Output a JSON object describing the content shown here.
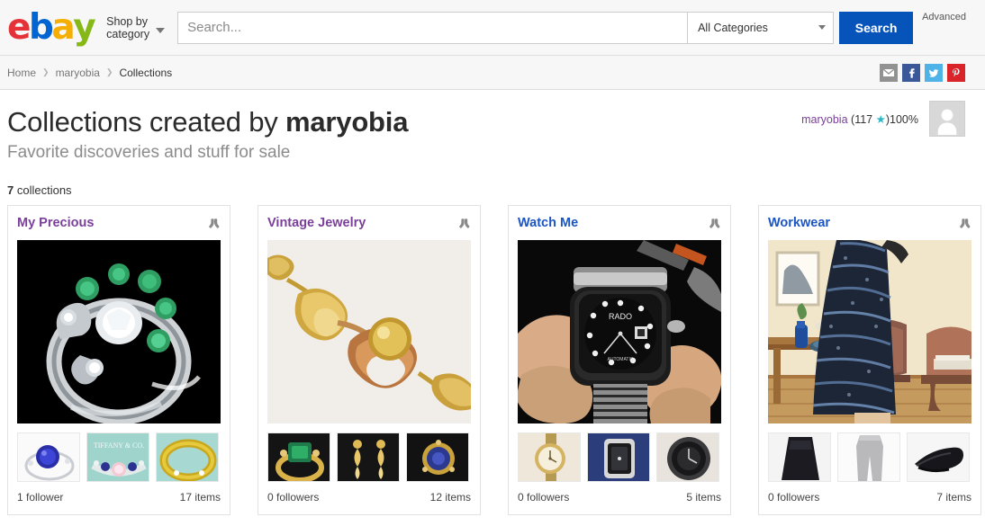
{
  "header": {
    "logo": {
      "letters": [
        "e",
        "b",
        "a",
        "y"
      ],
      "colors": [
        "#e53238",
        "#0064d2",
        "#f5af02",
        "#86b817"
      ]
    },
    "shop_by_category": "Shop by\ncategory",
    "shop_by_line1": "Shop by",
    "shop_by_line2": "category",
    "search_placeholder": "Search...",
    "search_value": "",
    "category_selected": "All Categories",
    "search_button": "Search",
    "advanced_link": "Advanced"
  },
  "breadcrumb": {
    "items": [
      {
        "label": "Home",
        "current": false
      },
      {
        "label": "maryobia",
        "current": false
      },
      {
        "label": "Collections",
        "current": true
      }
    ],
    "separator": "❯"
  },
  "social": [
    {
      "name": "email-share-icon",
      "label": "Email",
      "color": "#929292"
    },
    {
      "name": "facebook-share-icon",
      "label": "Facebook",
      "color": "#3b5998"
    },
    {
      "name": "twitter-share-icon",
      "label": "Twitter",
      "color": "#4fb3e8"
    },
    {
      "name": "pinterest-share-icon",
      "label": "Pinterest",
      "color": "#d9242a"
    }
  ],
  "page": {
    "title_prefix": "Collections created by ",
    "title_owner": "maryobia",
    "subtitle": "Favorite discoveries and stuff for sale",
    "user": {
      "name": "maryobia",
      "feedback_open": "(",
      "feedback_score": "117",
      "star": "★",
      "feedback_close": ")",
      "positive_percent": "100%"
    },
    "collections_count": "7",
    "collections_label": "collections"
  },
  "collections": [
    {
      "title": "My Precious",
      "visited": true,
      "followers": "1 follower",
      "items": "17 items",
      "hero_alt": "silver ring with diamonds and emeralds on black background",
      "thumbs": [
        "sapphire ring on white",
        "Tiffany & Co band on teal",
        "gold band on teal"
      ]
    },
    {
      "title": "Vintage Jewelry",
      "visited": true,
      "followers": "0 followers",
      "items": "12 items",
      "hero_alt": "gold and rose gold vintage bracelet link on white",
      "thumbs": [
        "emerald gold ring on black",
        "gold drop earrings on black",
        "sapphire cluster earring on black"
      ]
    },
    {
      "title": "Watch Me",
      "visited": false,
      "followers": "0 followers",
      "items": "5 items",
      "hero_alt": "black RADO automatic watch held in hand",
      "thumbs": [
        "gold wristwatch",
        "square watch on blue",
        "round dark watch face"
      ]
    },
    {
      "title": "Workwear",
      "visited": false,
      "followers": "0 followers",
      "items": "7 items",
      "hero_alt": "blue tweed pencil skirt worn in living room",
      "thumbs": [
        "black skirt",
        "gray trousers",
        "black flat shoes"
      ]
    }
  ],
  "colors": {
    "ebay_blue": "#0654ba",
    "link_visited": "#7a3f99",
    "link_unvisited": "#1b55c4",
    "star_teal": "#2fb8c6",
    "header_bg": "#f7f7f7"
  }
}
